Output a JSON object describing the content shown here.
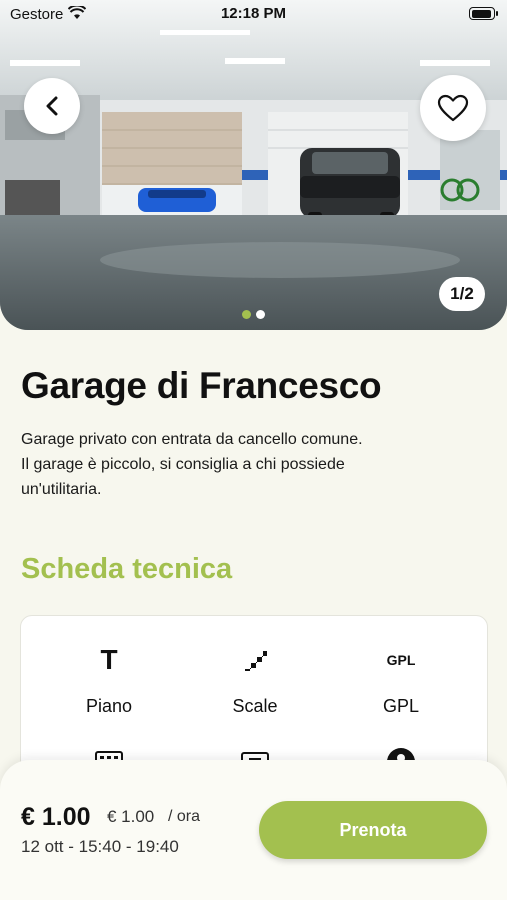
{
  "status_bar": {
    "carrier": "Gestore",
    "time": "12:18 PM"
  },
  "gallery": {
    "counter": "1/2",
    "total_images": 2,
    "active_index": 0
  },
  "listing": {
    "title": "Garage di Francesco",
    "description_lines": [
      "Garage privato con entrata da cancello comune.",
      "Il garage è piccolo, si consiglia a chi possiede",
      "un'utilitaria."
    ]
  },
  "specs": {
    "section_title": "Scheda tecnica",
    "items": [
      {
        "icon": "floor-T-icon",
        "icon_text": "T",
        "label": "Piano"
      },
      {
        "icon": "stairs-icon",
        "label": "Scale"
      },
      {
        "icon": "gpl-icon",
        "icon_text": "GPL",
        "label": "GPL"
      }
    ],
    "partial_icons": [
      "keypad-icon",
      "monitor-icon",
      "person-icon"
    ]
  },
  "booking": {
    "price": "€ 1.00",
    "hourly_price": "€ 1.00",
    "unit": "/ ora",
    "date_range": "12 ott - 15:40 - 19:40",
    "button_label": "Prenota"
  },
  "colors": {
    "accent": "#a3c04f",
    "background": "#f7f7ee"
  }
}
